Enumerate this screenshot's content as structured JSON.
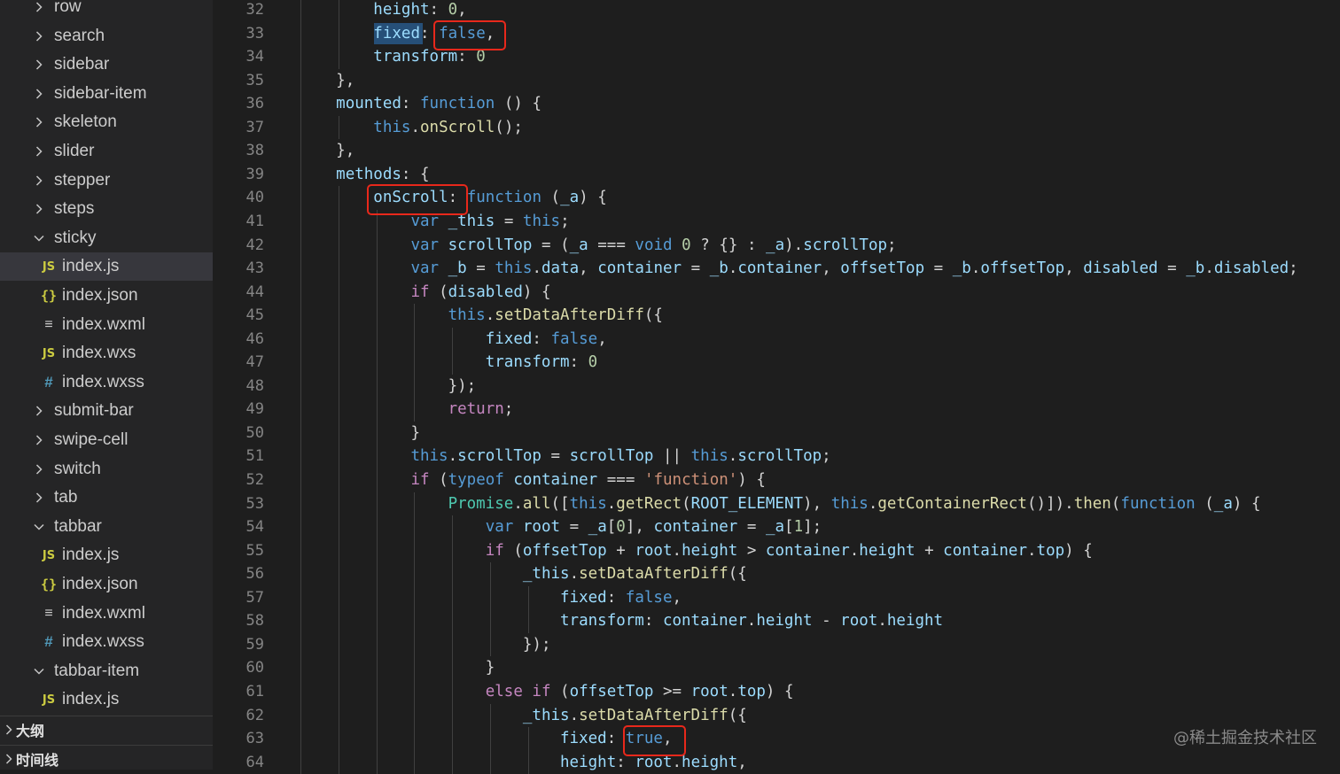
{
  "sidebar": {
    "rows": [
      {
        "label": "row",
        "type": "folder",
        "expanded": false,
        "depth": 1
      },
      {
        "label": "search",
        "type": "folder",
        "expanded": false,
        "depth": 1
      },
      {
        "label": "sidebar",
        "type": "folder",
        "expanded": false,
        "depth": 1
      },
      {
        "label": "sidebar-item",
        "type": "folder",
        "expanded": false,
        "depth": 1
      },
      {
        "label": "skeleton",
        "type": "folder",
        "expanded": false,
        "depth": 1
      },
      {
        "label": "slider",
        "type": "folder",
        "expanded": false,
        "depth": 1
      },
      {
        "label": "stepper",
        "type": "folder",
        "expanded": false,
        "depth": 1
      },
      {
        "label": "steps",
        "type": "folder",
        "expanded": false,
        "depth": 1
      },
      {
        "label": "sticky",
        "type": "folder",
        "expanded": true,
        "depth": 1
      },
      {
        "label": "index.js",
        "type": "js",
        "depth": 2,
        "selected": true
      },
      {
        "label": "index.json",
        "type": "json",
        "depth": 2
      },
      {
        "label": "index.wxml",
        "type": "wxml",
        "depth": 2
      },
      {
        "label": "index.wxs",
        "type": "js",
        "depth": 2
      },
      {
        "label": "index.wxss",
        "type": "wxss",
        "depth": 2
      },
      {
        "label": "submit-bar",
        "type": "folder",
        "expanded": false,
        "depth": 1
      },
      {
        "label": "swipe-cell",
        "type": "folder",
        "expanded": false,
        "depth": 1
      },
      {
        "label": "switch",
        "type": "folder",
        "expanded": false,
        "depth": 1
      },
      {
        "label": "tab",
        "type": "folder",
        "expanded": false,
        "depth": 1
      },
      {
        "label": "tabbar",
        "type": "folder",
        "expanded": true,
        "depth": 1
      },
      {
        "label": "index.js",
        "type": "js",
        "depth": 2
      },
      {
        "label": "index.json",
        "type": "json",
        "depth": 2
      },
      {
        "label": "index.wxml",
        "type": "wxml",
        "depth": 2
      },
      {
        "label": "index.wxss",
        "type": "wxss",
        "depth": 2
      },
      {
        "label": "tabbar-item",
        "type": "folder",
        "expanded": true,
        "depth": 1
      },
      {
        "label": "index.js",
        "type": "js",
        "depth": 2
      }
    ],
    "icons": {
      "js": "JS",
      "json": "{}",
      "wxml": "≡",
      "wxss": "#"
    },
    "outline_label": "大纲",
    "timeline_label": "时间线"
  },
  "editor": {
    "line_numbers": [
      "32",
      "33",
      "34",
      "35",
      "36",
      "37",
      "38",
      "39",
      "40",
      "41",
      "42",
      "43",
      "44",
      "45",
      "46",
      "47",
      "48",
      "49",
      "50",
      "51",
      "52",
      "53",
      "54",
      "55",
      "56",
      "57",
      "58",
      "59",
      "60",
      "61",
      "62",
      "63",
      "64"
    ],
    "lines": [
      "        height: 0,",
      "        fixed: false,",
      "        transform: 0",
      "    },",
      "    mounted: function () {",
      "        this.onScroll();",
      "    },",
      "    methods: {",
      "        onScroll: function (_a) {",
      "            var _this = this;",
      "            var scrollTop = (_a === void 0 ? {} : _a).scrollTop;",
      "            var _b = this.data, container = _b.container, offsetTop = _b.offsetTop, disabled = _b.disabled;",
      "            if (disabled) {",
      "                this.setDataAfterDiff({",
      "                    fixed: false,",
      "                    transform: 0",
      "                });",
      "                return;",
      "            }",
      "            this.scrollTop = scrollTop || this.scrollTop;",
      "            if (typeof container === 'function') {",
      "                Promise.all([this.getRect(ROOT_ELEMENT), this.getContainerRect()]).then(function (_a) {",
      "                    var root = _a[0], container = _a[1];",
      "                    if (offsetTop + root.height > container.height + container.top) {",
      "                        _this.setDataAfterDiff({",
      "                            fixed: false,",
      "                            transform: container.height - root.height",
      "                        });",
      "                    }",
      "                    else if (offsetTop >= root.top) {",
      "                        _this.setDataAfterDiff({",
      "                            fixed: true,",
      "                            height: root.height,"
    ]
  },
  "colors": {
    "keyword": "#569cd6",
    "control": "#c586c0",
    "property": "#9cdcfe",
    "function": "#dcdcaa",
    "string": "#ce9178",
    "number": "#b5cea8",
    "class": "#4ec9b0",
    "highlight_box": "#e8281b"
  },
  "watermark": "@稀土掘金技术社区"
}
